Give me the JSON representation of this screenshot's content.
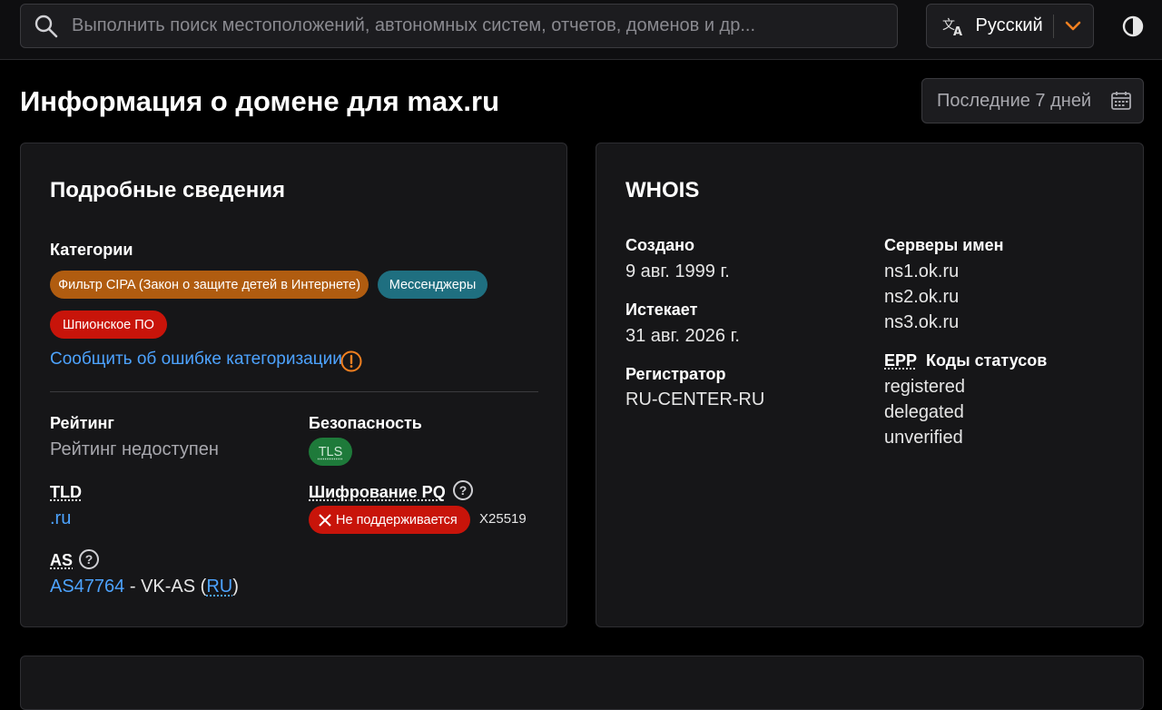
{
  "header": {
    "search_placeholder": "Выполнить поиск местоположений, автономных систем, отчетов, доменов и др...",
    "language": "Русский",
    "accent_color": "#f38020"
  },
  "page": {
    "title": "Информация о домене для max.ru",
    "date_range": "Последние 7 дней"
  },
  "details": {
    "title": "Подробные сведения",
    "categories_label": "Категории",
    "categories": [
      {
        "label": "Фильтр CIPA (Закон о защите детей в Интернете)",
        "color": "#b05c10"
      },
      {
        "label": "Мессенджеры",
        "color": "#1f6f80"
      },
      {
        "label": "Шпионское ПО",
        "color": "#c8140a"
      }
    ],
    "report_link": "Сообщить об ошибке категоризации",
    "rating_label": "Рейтинг",
    "rating_value": "Рейтинг недоступен",
    "security_label": "Безопасность",
    "security_badge": "TLS",
    "tld_label": "TLD",
    "tld_value": ".ru",
    "pq_label": "Шифрование PQ",
    "pq_badge": "Не поддерживается",
    "pq_extra": "X25519",
    "as_label": "AS",
    "as_number": "AS47764",
    "as_separator": " - VK-AS (",
    "as_country": "RU",
    "as_close": ")"
  },
  "whois": {
    "title": "WHOIS",
    "created_label": "Создано",
    "created_value": "9 авг. 1999 г.",
    "expires_label": "Истекает",
    "expires_value": "31 авг. 2026 г.",
    "registrar_label": "Регистратор",
    "registrar_value": "RU-CENTER-RU",
    "nameservers_label": "Серверы имен",
    "nameservers": [
      "ns1.ok.ru",
      "ns2.ok.ru",
      "ns3.ok.ru"
    ],
    "epp_prefix": "EPP",
    "epp_label": "Коды статусов",
    "epp_statuses": [
      "registered",
      "delegated",
      "unverified"
    ]
  }
}
